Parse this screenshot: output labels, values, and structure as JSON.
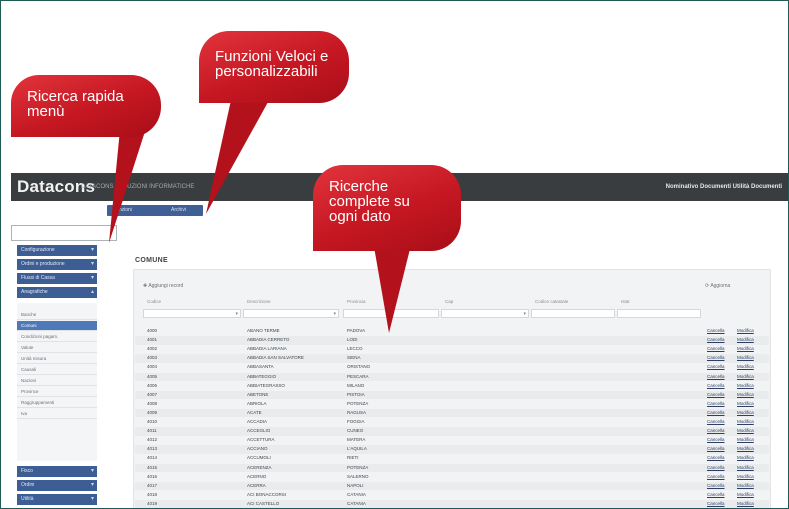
{
  "header": {
    "brand": "Datacons",
    "brand_sub": "DATACONS SOLUZIONI INFORMATICHE",
    "user_area": "Nominativo Documenti Utilità  Documenti"
  },
  "quick_buttons": [
    "Funzioni",
    "Archivi"
  ],
  "menu": {
    "search_placeholder": "",
    "sections_top": [
      "Configurazione",
      "Ordini e produzione",
      "Flussi di Cassa",
      "Anagrafiche"
    ],
    "items": [
      "Banche",
      "Comuni",
      "Condizioni pagam.",
      "Valute",
      "Unità misura",
      "Causali",
      "Nazioni",
      "Province",
      "Raggruppamenti",
      "Iva"
    ],
    "active_index": 1,
    "sections_bottom": [
      "Fisco",
      "Ordini",
      "Utilità"
    ]
  },
  "content": {
    "title": "COMUNE",
    "add_record": "Aggiungi record",
    "refresh": "Aggiorna",
    "columns": [
      "Codice",
      "Descrizione",
      "Provincia",
      "Cap",
      "Codice catastale",
      "Istat"
    ],
    "rows": [
      {
        "code": "4000",
        "desc": "ABANO TERME",
        "prov": "PADOVA"
      },
      {
        "code": "4001",
        "desc": "ABBADIA CERRETO",
        "prov": "LODI"
      },
      {
        "code": "4002",
        "desc": "ABBADIA LARIANA",
        "prov": "LECCO"
      },
      {
        "code": "4003",
        "desc": "ABBADIA SAN SALVATORE",
        "prov": "SIENA"
      },
      {
        "code": "4004",
        "desc": "ABBASANTA",
        "prov": "ORISTANO"
      },
      {
        "code": "4005",
        "desc": "ABBATEGGIO",
        "prov": "PESCARA"
      },
      {
        "code": "4006",
        "desc": "ABBIATEGRASSO",
        "prov": "MILANO"
      },
      {
        "code": "4007",
        "desc": "ABETONE",
        "prov": "PISTOIA"
      },
      {
        "code": "4008",
        "desc": "ABRIOLA",
        "prov": "POTENZA"
      },
      {
        "code": "4009",
        "desc": "ACATE",
        "prov": "RAGUSA"
      },
      {
        "code": "4010",
        "desc": "ACCADIA",
        "prov": "FOGGIA"
      },
      {
        "code": "4011",
        "desc": "ACCEGLIO",
        "prov": "CUNEO"
      },
      {
        "code": "4012",
        "desc": "ACCETTURA",
        "prov": "MATERA"
      },
      {
        "code": "4013",
        "desc": "ACCIANO",
        "prov": "L'AQUILA"
      },
      {
        "code": "4014",
        "desc": "ACCUMOLI",
        "prov": "RIETI"
      },
      {
        "code": "4015",
        "desc": "ACERENZA",
        "prov": "POTENZA"
      },
      {
        "code": "4016",
        "desc": "ACERNO",
        "prov": "SALERNO"
      },
      {
        "code": "4017",
        "desc": "ACERRA",
        "prov": "NAPOLI"
      },
      {
        "code": "4018",
        "desc": "ACI BONACCORSI",
        "prov": "CATANIA"
      },
      {
        "code": "4019",
        "desc": "ACI CASTELLO",
        "prov": "CATANIA"
      }
    ],
    "action_delete": "Cancella",
    "action_edit": "Modifica"
  },
  "callouts": {
    "ricerca_menu": [
      "Ricerca rapida",
      "menù"
    ],
    "funzioni": [
      "Funzioni Veloci e",
      "personalizzabili"
    ],
    "ricerche": [
      "Ricerche",
      "complete su",
      "ogni dato"
    ]
  },
  "colors": {
    "callout": "#c51722",
    "menu_section": "#3d5e94",
    "topbar": "#3a3d3f",
    "frame": "#1e5b56"
  }
}
